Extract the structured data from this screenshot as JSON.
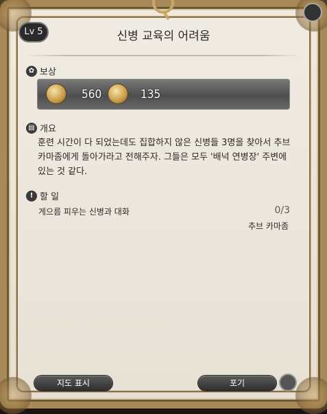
{
  "header": {
    "level_label": "Lv 5",
    "title": "신병 교육의 어려움"
  },
  "rewards": {
    "label": "보상",
    "items": [
      {
        "icon": "exp-icon",
        "value": "560"
      },
      {
        "icon": "gil-coin-icon",
        "value": "135"
      }
    ]
  },
  "summary": {
    "label": "개요",
    "text": "훈련 시간이 다 되었는데도 집합하지 않은 신병들 3명을 찾아서 추브 카마좀에게 돌아가라고 전해주자. 그들은 모두 '배넉 연병장' 주변에 있는 것 같다."
  },
  "objectives": {
    "label": "할 일",
    "items": [
      {
        "text": "게으름 피우는 신병과 대화",
        "count": "0/3",
        "location": "추브 카마좀"
      }
    ]
  },
  "footer": {
    "map_button": "지도 표시",
    "abandon_button": "포기"
  }
}
